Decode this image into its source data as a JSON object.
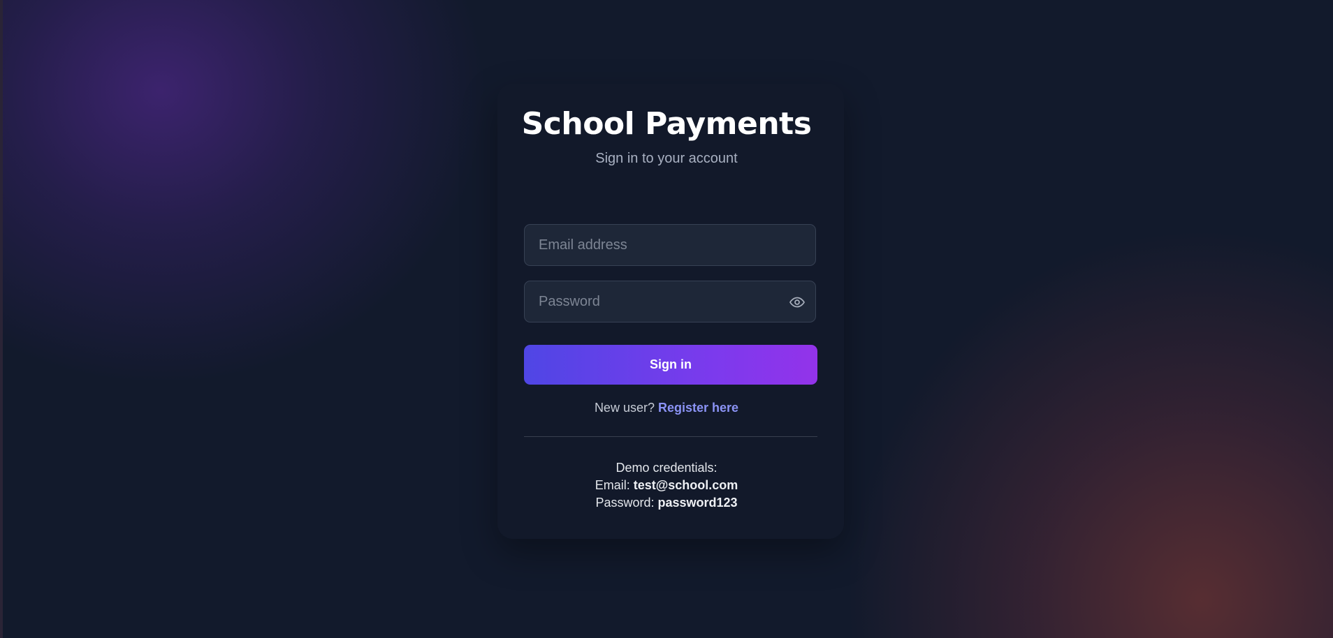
{
  "page": {
    "title": "School Payments",
    "subtitle": "Sign in to your account"
  },
  "form": {
    "email": {
      "value": "",
      "placeholder": "Email address"
    },
    "password": {
      "value": "",
      "placeholder": "Password",
      "toggle_icon": "eye-icon"
    },
    "submit_label": "Sign in"
  },
  "register": {
    "prompt": "New user?",
    "link_label": "Register here"
  },
  "demo": {
    "heading": "Demo credentials:",
    "email_label": "Email:",
    "email_value": "test@school.com",
    "password_label": "Password:",
    "password_value": "password123"
  },
  "colors": {
    "background": "#121a2c",
    "accent_start": "#4f46e5",
    "accent_end": "#9333ea",
    "link": "#8b93f5"
  }
}
